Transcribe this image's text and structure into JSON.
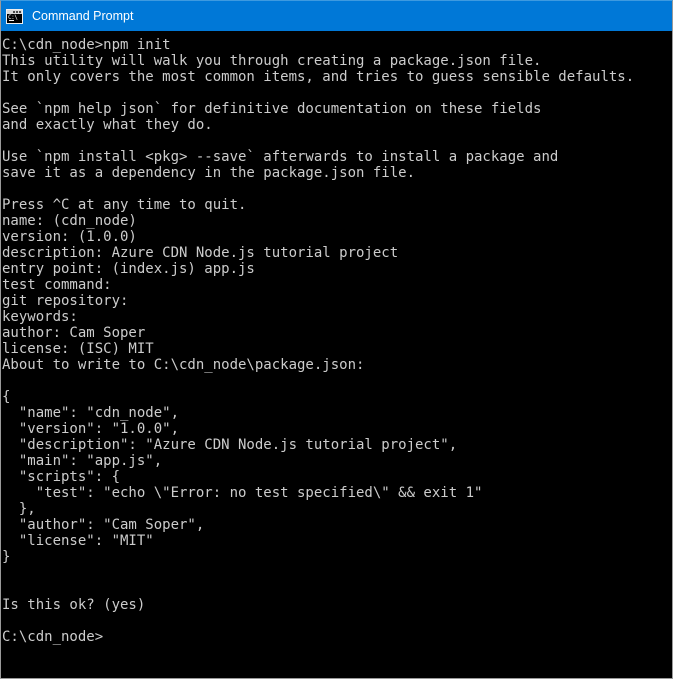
{
  "window": {
    "title": "Command Prompt",
    "icon": "command-prompt-icon",
    "icon_glyph": "C:\\",
    "titlebar_color": "#0078d7",
    "titlebar_text_color": "#ffffff",
    "background_color": "#000000",
    "text_color": "#cccccc",
    "border_color": "#9a9a9a"
  },
  "console": {
    "prompt": "C:\\cdn_node>",
    "command": "npm init",
    "lines": [
      "C:\\cdn_node>npm init",
      "This utility will walk you through creating a package.json file.",
      "It only covers the most common items, and tries to guess sensible defaults.",
      "",
      "See `npm help json` for definitive documentation on these fields",
      "and exactly what they do.",
      "",
      "Use `npm install <pkg> --save` afterwards to install a package and",
      "save it as a dependency in the package.json file.",
      "",
      "Press ^C at any time to quit.",
      "name: (cdn_node)",
      "version: (1.0.0)",
      "description: Azure CDN Node.js tutorial project",
      "entry point: (index.js) app.js",
      "test command:",
      "git repository:",
      "keywords:",
      "author: Cam Soper",
      "license: (ISC) MIT",
      "About to write to C:\\cdn_node\\package.json:",
      "",
      "{",
      "  \"name\": \"cdn_node\",",
      "  \"version\": \"1.0.0\",",
      "  \"description\": \"Azure CDN Node.js tutorial project\",",
      "  \"main\": \"app.js\",",
      "  \"scripts\": {",
      "    \"test\": \"echo \\\"Error: no test specified\\\" && exit 1\"",
      "  },",
      "  \"author\": \"Cam Soper\",",
      "  \"license\": \"MIT\"",
      "}",
      "",
      "",
      "Is this ok? (yes)",
      "",
      "C:\\cdn_node>"
    ],
    "prompt_answers": {
      "name": "(cdn_node)",
      "version": "(1.0.0)",
      "description": "Azure CDN Node.js tutorial project",
      "entry_point_default": "(index.js)",
      "entry_point_value": "app.js",
      "test_command": "",
      "git_repository": "",
      "keywords": "",
      "author": "Cam Soper",
      "license_default": "(ISC)",
      "license_value": "MIT",
      "target_file": "C:\\cdn_node\\package.json",
      "confirm": "Is this ok? (yes)"
    },
    "package_json": {
      "name": "cdn_node",
      "version": "1.0.0",
      "description": "Azure CDN Node.js tutorial project",
      "main": "app.js",
      "scripts_test": "echo \\\"Error: no test specified\\\" && exit 1",
      "author": "Cam Soper",
      "license": "MIT"
    }
  }
}
